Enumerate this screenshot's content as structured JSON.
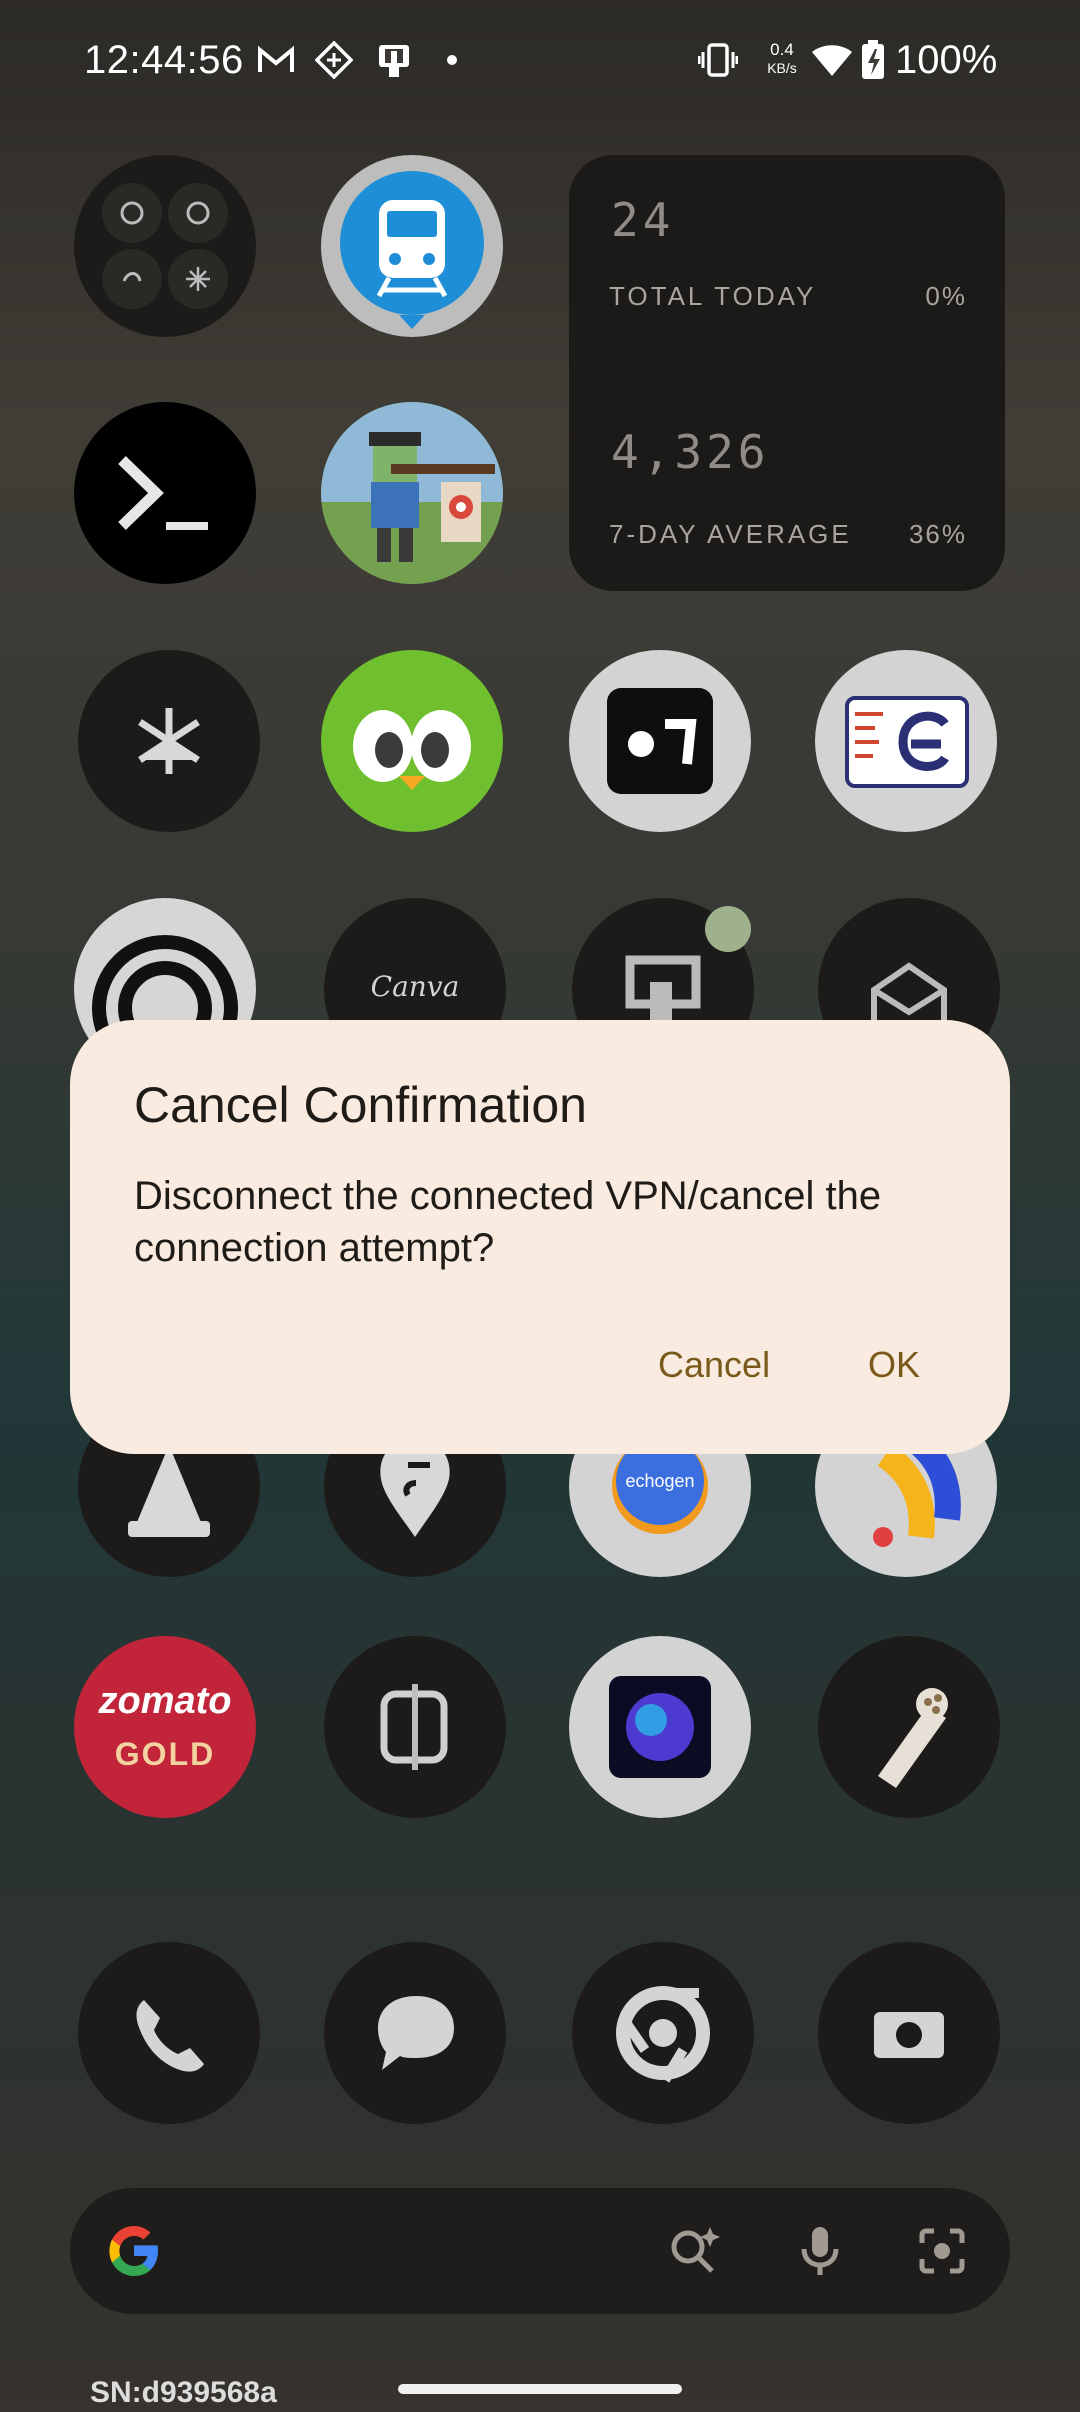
{
  "status_bar": {
    "time": "12:44:56",
    "net_speed_value": "0.4",
    "net_speed_unit": "KB/s",
    "battery_percent": "100%",
    "icons": [
      "gmail-icon",
      "vpn-diamond-icon",
      "cast-icon",
      "dot-icon",
      "vibrate-icon",
      "wifi-icon",
      "battery-charging-icon"
    ]
  },
  "widget": {
    "today_value": "24",
    "today_label": "TOTAL TODAY",
    "today_pct": "0%",
    "avg_value": "4,326",
    "avg_label": "7-DAY AVERAGE",
    "avg_pct": "36%"
  },
  "apps": {
    "canva_label": "Canva",
    "echogen_label": "echogen",
    "zomato_label": "zomato",
    "zomato_sub": "GOLD"
  },
  "dialog": {
    "title": "Cancel Confirmation",
    "message": "Disconnect the connected VPN/cancel the connection attempt?",
    "cancel_label": "Cancel",
    "ok_label": "OK"
  },
  "footer": {
    "serial": "SN:d939568a"
  },
  "colors": {
    "dialog_bg": "#faebe0",
    "dialog_button": "#7a5a1a",
    "icon_bg": "#1c1b19"
  }
}
